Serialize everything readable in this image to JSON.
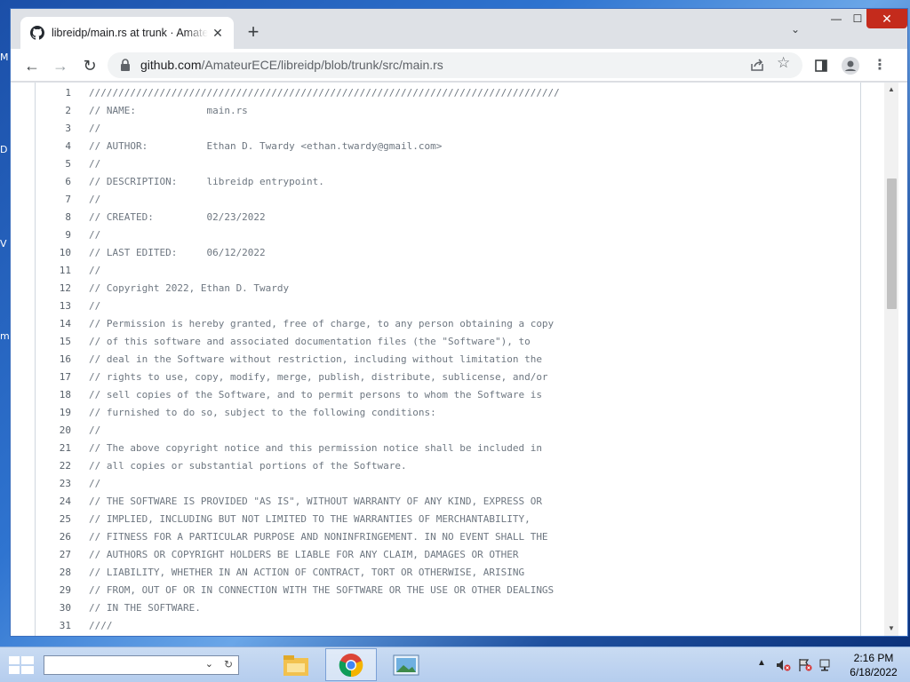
{
  "browser": {
    "tab": {
      "title": "libreidp/main.rs at trunk · AmateurECE/libreidp",
      "icon": "github-icon"
    },
    "new_tab_label": "+",
    "url_host": "github.com",
    "url_path": "/AmateurECE/libreidp/blob/trunk/src/main.rs"
  },
  "code": {
    "lines": [
      {
        "n": "1",
        "text": "////////////////////////////////////////////////////////////////////////////////"
      },
      {
        "n": "2",
        "text": "// NAME:            main.rs"
      },
      {
        "n": "3",
        "text": "//"
      },
      {
        "n": "4",
        "text": "// AUTHOR:          Ethan D. Twardy <ethan.twardy@gmail.com>"
      },
      {
        "n": "5",
        "text": "//"
      },
      {
        "n": "6",
        "text": "// DESCRIPTION:     libreidp entrypoint."
      },
      {
        "n": "7",
        "text": "//"
      },
      {
        "n": "8",
        "text": "// CREATED:         02/23/2022"
      },
      {
        "n": "9",
        "text": "//"
      },
      {
        "n": "10",
        "text": "// LAST EDITED:     06/12/2022"
      },
      {
        "n": "11",
        "text": "//"
      },
      {
        "n": "12",
        "text": "// Copyright 2022, Ethan D. Twardy"
      },
      {
        "n": "13",
        "text": "//"
      },
      {
        "n": "14",
        "text": "// Permission is hereby granted, free of charge, to any person obtaining a copy"
      },
      {
        "n": "15",
        "text": "// of this software and associated documentation files (the \"Software\"), to"
      },
      {
        "n": "16",
        "text": "// deal in the Software without restriction, including without limitation the"
      },
      {
        "n": "17",
        "text": "// rights to use, copy, modify, merge, publish, distribute, sublicense, and/or"
      },
      {
        "n": "18",
        "text": "// sell copies of the Software, and to permit persons to whom the Software is"
      },
      {
        "n": "19",
        "text": "// furnished to do so, subject to the following conditions:"
      },
      {
        "n": "20",
        "text": "//"
      },
      {
        "n": "21",
        "text": "// The above copyright notice and this permission notice shall be included in"
      },
      {
        "n": "22",
        "text": "// all copies or substantial portions of the Software."
      },
      {
        "n": "23",
        "text": "//"
      },
      {
        "n": "24",
        "text": "// THE SOFTWARE IS PROVIDED \"AS IS\", WITHOUT WARRANTY OF ANY KIND, EXPRESS OR"
      },
      {
        "n": "25",
        "text": "// IMPLIED, INCLUDING BUT NOT LIMITED TO THE WARRANTIES OF MERCHANTABILITY,"
      },
      {
        "n": "26",
        "text": "// FITNESS FOR A PARTICULAR PURPOSE AND NONINFRINGEMENT. IN NO EVENT SHALL THE"
      },
      {
        "n": "27",
        "text": "// AUTHORS OR COPYRIGHT HOLDERS BE LIABLE FOR ANY CLAIM, DAMAGES OR OTHER"
      },
      {
        "n": "28",
        "text": "// LIABILITY, WHETHER IN AN ACTION OF CONTRACT, TORT OR OTHERWISE, ARISING"
      },
      {
        "n": "29",
        "text": "// FROM, OUT OF OR IN CONNECTION WITH THE SOFTWARE OR THE USE OR OTHER DEALINGS"
      },
      {
        "n": "30",
        "text": "// IN THE SOFTWARE."
      },
      {
        "n": "31",
        "text": "////"
      }
    ]
  },
  "taskbar": {
    "clock_time": "2:16 PM",
    "clock_date": "6/18/2022",
    "items": [
      "file-explorer-icon",
      "chrome-icon",
      "image-viewer-icon"
    ]
  },
  "colors": {
    "accent": "#0969da",
    "close_red": "#c42b1c",
    "comment": "#6e7781"
  }
}
